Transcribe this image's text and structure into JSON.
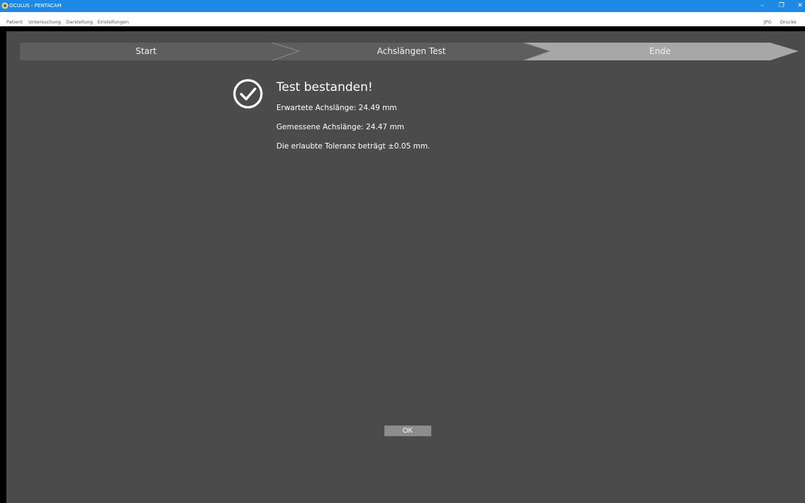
{
  "window": {
    "title": "OCULUS - PENTACAM",
    "controls": {
      "minimize": "–",
      "restore": "❐",
      "close": "✕"
    }
  },
  "menu": {
    "items": [
      "Patient",
      "Untersuchung",
      "Darstellung",
      "Einstellungen"
    ],
    "right_items": [
      "JPG",
      "Drucke"
    ]
  },
  "wizard": {
    "steps": [
      {
        "label": "Start",
        "state": "done"
      },
      {
        "label": "Achslängen Test",
        "state": "done"
      },
      {
        "label": "Ende",
        "state": "active"
      }
    ]
  },
  "result": {
    "icon": "check-circle-icon",
    "title": "Test bestanden!",
    "expected": "Erwartete Achslänge: 24.49 mm",
    "measured": "Gemessene Achslänge: 24.47 mm",
    "tolerance": "Die erlaubte Toleranz beträgt ±0.05 mm."
  },
  "ok_button": {
    "label": "OK"
  },
  "colors": {
    "titlebar": "#1e88e5",
    "background": "#4b4b4b",
    "step_done": "#5e5e5e",
    "step_active": "#a7a7a7",
    "ok_button": "#8c8c8c"
  }
}
